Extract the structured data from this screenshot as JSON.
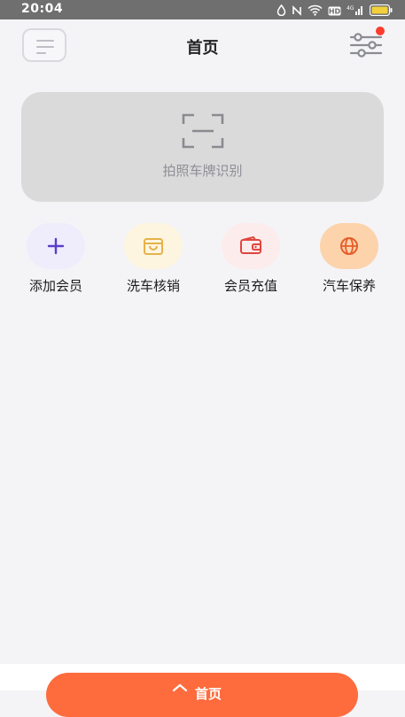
{
  "status_bar": {
    "time": "20:04"
  },
  "header": {
    "title": "首页"
  },
  "scan": {
    "label": "拍照车牌识别"
  },
  "actions": [
    {
      "label": "添加会员",
      "icon": "plus-icon",
      "bg": "#efecfc",
      "color": "#5b3fc9"
    },
    {
      "label": "洗车核销",
      "icon": "bag-icon",
      "bg": "#fdf5df",
      "color": "#e4b24a"
    },
    {
      "label": "会员充值",
      "icon": "wallet-icon",
      "bg": "#fdecec",
      "color": "#e0463f"
    },
    {
      "label": "汽车保养",
      "icon": "globe-icon",
      "bg": "#fdd3ac",
      "color": "#e65e2a"
    }
  ],
  "bottom_nav": {
    "home_label": "首页",
    "accent": "#fe6b3d"
  }
}
